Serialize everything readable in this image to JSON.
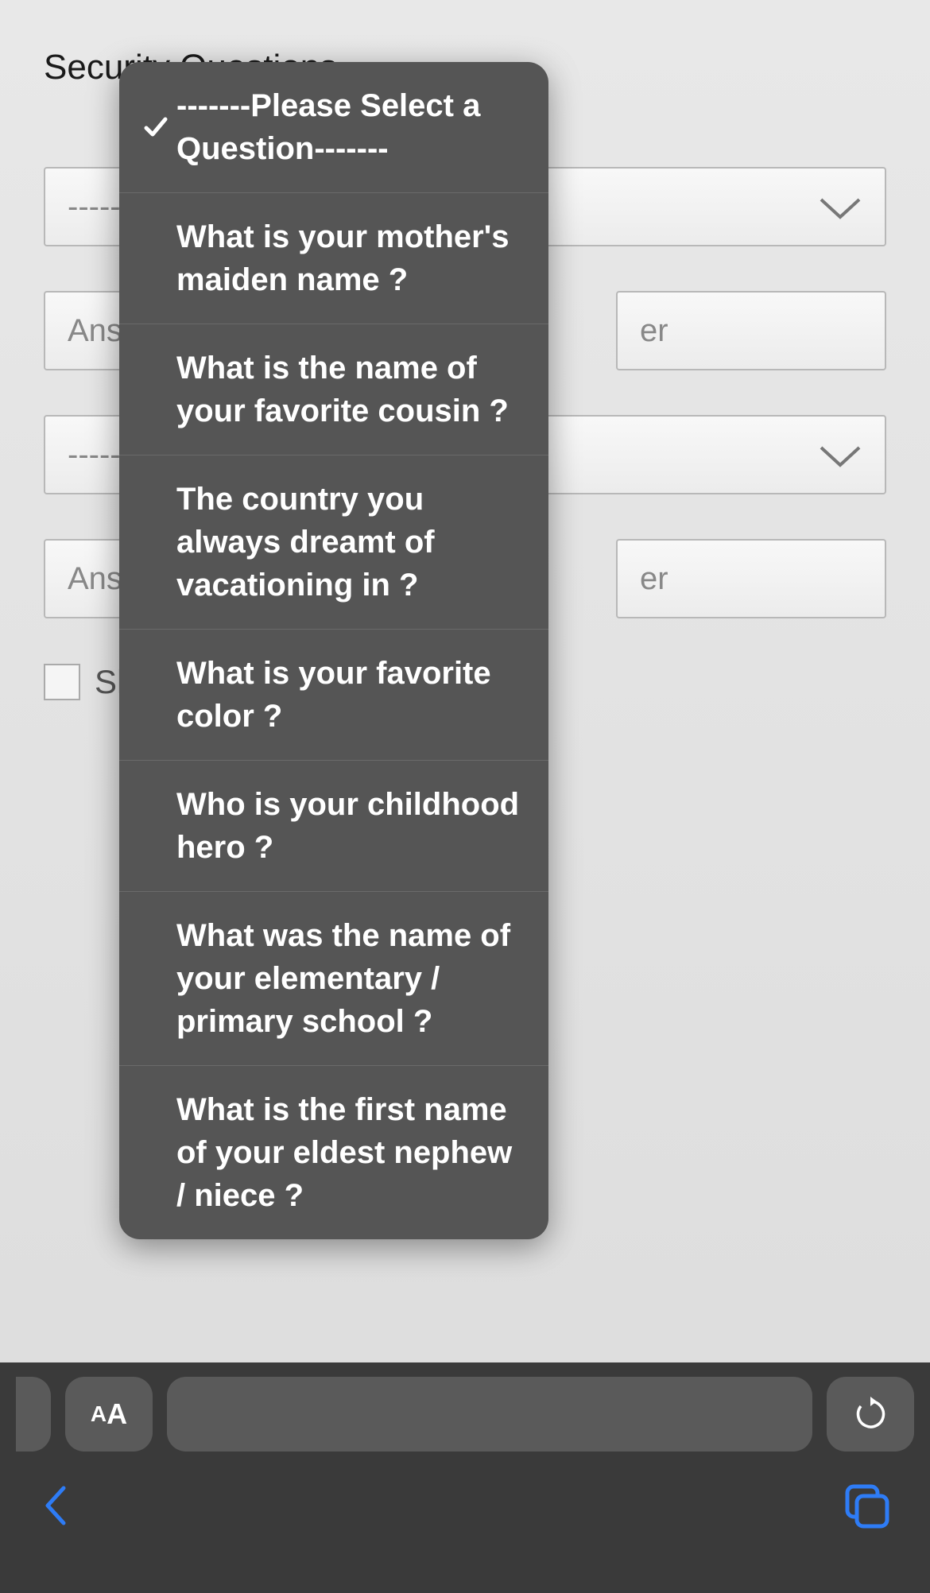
{
  "heading": "Security Questions",
  "form": {
    "select1_placeholder_left": "-----",
    "select2_placeholder_left": "-----",
    "answer1_left": "Answ",
    "answer1_right": "er",
    "answer2_left": "Answ",
    "answer2_right": "er",
    "show_label": "Sh"
  },
  "toolbar": {
    "aa_small": "A",
    "aa_large": "A"
  },
  "dropdown": {
    "options": [
      "-------Please Select a Question-------",
      "What is your mother's maiden name ?",
      "What is the name of your favorite cousin ?",
      "The country you always dreamt of vacationing in ?",
      "What is your favorite color ?",
      "Who is your childhood hero ?",
      "What was the name of your elementary / primary school ?",
      "What is the first name of your eldest nephew / niece ?"
    ],
    "selected_index": 0
  }
}
